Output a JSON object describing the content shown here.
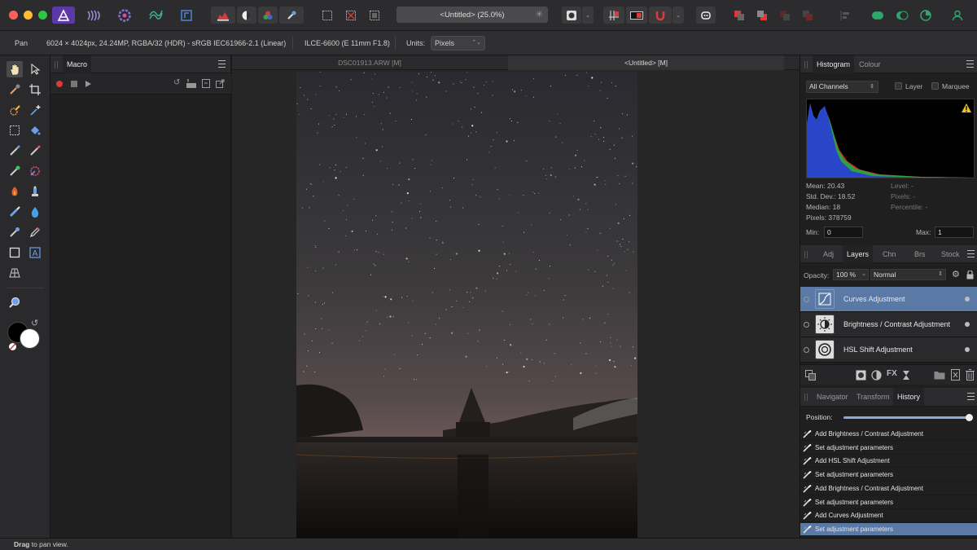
{
  "document": {
    "title": "<Untitled> (25.0%)"
  },
  "context_bar": {
    "tool": "Pan",
    "image_info": "6024 × 4024px, 24.24MP, RGBA/32 (HDR) - sRGB IEC61966-2.1 (Linear)",
    "camera": "ILCE-6600 (E 11mm F1.8)",
    "units_label": "Units:",
    "units_value": "Pixels"
  },
  "macro_panel": {
    "tab": "Macro"
  },
  "doc_tabs": [
    "DSC01913.ARW [M]",
    "<Untitled> [M]"
  ],
  "histogram": {
    "tabs": [
      "Histogram",
      "Colour"
    ],
    "channel": "All Channels",
    "layer_label": "Layer",
    "marquee_label": "Marquee",
    "stats_left": [
      "Mean: 20.43",
      "Std. Dev.: 18.52",
      "Median: 18",
      "Pixels: 378759"
    ],
    "stats_right": [
      "Level: -",
      "Pixels: -",
      "Percentile: -"
    ],
    "min_label": "Min:",
    "min_value": "0",
    "max_label": "Max:",
    "max_value": "1"
  },
  "layers_panel": {
    "tabs": [
      "Adj",
      "Layers",
      "Chn",
      "Brs",
      "Stock"
    ],
    "opacity_label": "Opacity:",
    "opacity_value": "100 %",
    "blend_mode": "Normal",
    "layers": [
      {
        "name": "Curves Adjustment"
      },
      {
        "name": "Brightness / Contrast Adjustment"
      },
      {
        "name": "HSL Shift Adjustment"
      }
    ]
  },
  "history_panel": {
    "tabs": [
      "Navigator",
      "Transform",
      "History"
    ],
    "position_label": "Position:",
    "position_fraction": 1.0,
    "items": [
      "Add Brightness / Contrast Adjustment",
      "Set adjustment parameters",
      "Add HSL Shift Adjustment",
      "Set adjustment parameters",
      "Add Brightness / Contrast Adjustment",
      "Set adjustment parameters",
      "Add Curves Adjustment",
      "Set adjustment parameters"
    ]
  },
  "status": {
    "bold": "Drag",
    "text": " to pan view."
  },
  "colors": {
    "accent": "#5a7aa5",
    "selection": "#5a7aa5"
  }
}
